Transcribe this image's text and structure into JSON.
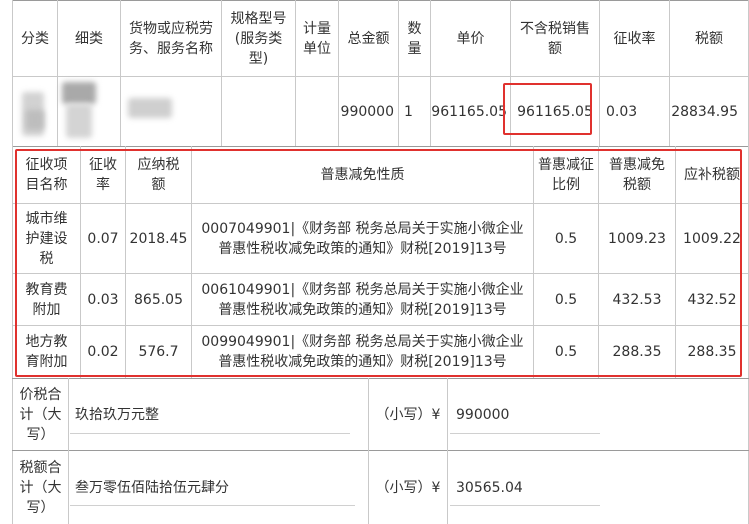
{
  "top_header": {
    "category": "分类",
    "subcategory": "细类",
    "goods_name": "货物或应税劳务、服务名称",
    "spec_model": "规格型号(服务类型)",
    "unit": "计量单位",
    "total_amount": "总金额",
    "quantity": "数量",
    "unit_price": "单价",
    "amount_excl_tax": "不含税销售额",
    "tax_rate": "征收率",
    "tax": "税额"
  },
  "item_row": {
    "total_amount": "990000",
    "quantity": "1",
    "unit_price": "961165.05",
    "amount_excl_tax": "961165.05",
    "tax_rate": "0.03",
    "tax": "28834.95"
  },
  "surcharge_header": {
    "item_name": "征收项目名称",
    "rate": "征收率",
    "payable": "应纳税额",
    "nature": "普惠减免性质",
    "reduction_ratio": "普惠减征比例",
    "reduction_amount": "普惠减免税额",
    "supplement": "应补税额"
  },
  "surcharge_rows": [
    {
      "name": "城市维护建设税",
      "rate": "0.07",
      "payable": "2018.45",
      "nature": "0007049901|《财务部 税务总局关于实施小微企业普惠性税收减免政策的通知》财税[2019]13号",
      "ratio": "0.5",
      "reduction": "1009.23",
      "supplement": "1009.22"
    },
    {
      "name": "教育费附加",
      "rate": "0.03",
      "payable": "865.05",
      "nature": "0061049901|《财务部 税务总局关于实施小微企业普惠性税收减免政策的通知》财税[2019]13号",
      "ratio": "0.5",
      "reduction": "432.53",
      "supplement": "432.52"
    },
    {
      "name": "地方教育附加",
      "rate": "0.02",
      "payable": "576.7",
      "nature": "0099049901|《财务部 税务总局关于实施小微企业普惠性税收减免政策的通知》财税[2019]13号",
      "ratio": "0.5",
      "reduction": "288.35",
      "supplement": "288.35"
    }
  ],
  "totals": {
    "price_tax_label": "价税合计（大写）",
    "price_tax_upper": "玖拾玖万元整",
    "small_label_1": "（小写）¥",
    "price_tax_lower": "990000",
    "tax_total_label": "税额合计（大写）",
    "tax_total_upper": "叁万零伍佰陆拾伍元肆分",
    "small_label_2": "（小写）¥",
    "tax_total_lower": "30565.04"
  },
  "colors": {
    "highlight": "#e0312e",
    "grid": "#c9c9c9",
    "text": "#333333"
  }
}
